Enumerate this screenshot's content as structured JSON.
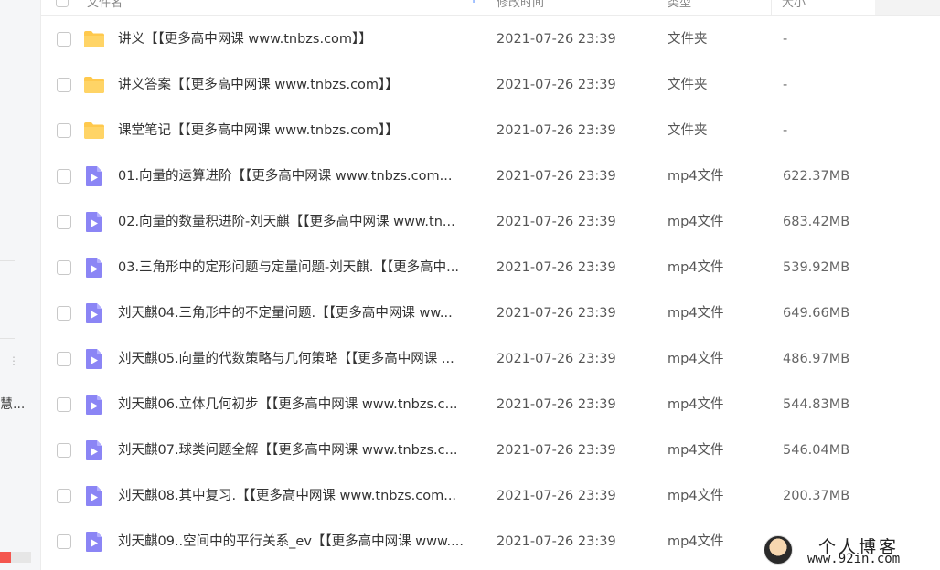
{
  "sidebar": {
    "truncated_text": "慧...",
    "dots": "⋮"
  },
  "header": {
    "name_label": "文件名",
    "time_label": "修改时间",
    "type_label": "类型",
    "size_label": "大小",
    "sort_glyph": "↑"
  },
  "files": [
    {
      "name": "讲义【【更多高中网课 www.tnbzs.com】】",
      "modified": "2021-07-26 23:39",
      "type": "文件夹",
      "size": "-",
      "icon": "folder-icon"
    },
    {
      "name": "讲义答案【【更多高中网课 www.tnbzs.com】】",
      "modified": "2021-07-26 23:39",
      "type": "文件夹",
      "size": "-",
      "icon": "folder-icon"
    },
    {
      "name": "课堂笔记【【更多高中网课 www.tnbzs.com】】",
      "modified": "2021-07-26 23:39",
      "type": "文件夹",
      "size": "-",
      "icon": "folder-icon"
    },
    {
      "name": "01.向量的运算进阶【【更多高中网课 www.tnbzs.com...",
      "modified": "2021-07-26 23:39",
      "type": "mp4文件",
      "size": "622.37MB",
      "icon": "video-file-icon"
    },
    {
      "name": "02.向量的数量积进阶-刘天麒【【更多高中网课 www.tn...",
      "modified": "2021-07-26 23:39",
      "type": "mp4文件",
      "size": "683.42MB",
      "icon": "video-file-icon"
    },
    {
      "name": "03.三角形中的定形问题与定量问题-刘天麒.【【更多高中...",
      "modified": "2021-07-26 23:39",
      "type": "mp4文件",
      "size": "539.92MB",
      "icon": "video-file-icon"
    },
    {
      "name": "刘天麒04.三角形中的不定量问题.【【更多高中网课 ww...",
      "modified": "2021-07-26 23:39",
      "type": "mp4文件",
      "size": "649.66MB",
      "icon": "video-file-icon"
    },
    {
      "name": "刘天麒05.向量的代数策略与几何策略【【更多高中网课 ...",
      "modified": "2021-07-26 23:39",
      "type": "mp4文件",
      "size": "486.97MB",
      "icon": "video-file-icon"
    },
    {
      "name": "刘天麒06.立体几何初步【【更多高中网课 www.tnbzs.c...",
      "modified": "2021-07-26 23:39",
      "type": "mp4文件",
      "size": "544.83MB",
      "icon": "video-file-icon"
    },
    {
      "name": "刘天麒07.球类问题全解【【更多高中网课 www.tnbzs.c...",
      "modified": "2021-07-26 23:39",
      "type": "mp4文件",
      "size": "546.04MB",
      "icon": "video-file-icon"
    },
    {
      "name": "刘天麒08.其中复习.【【更多高中网课 www.tnbzs.com...",
      "modified": "2021-07-26 23:39",
      "type": "mp4文件",
      "size": "200.37MB",
      "icon": "video-file-icon"
    },
    {
      "name": "刘天麒09..空间中的平行关系_ev【【更多高中网课 www....",
      "modified": "2021-07-26 23:39",
      "type": "mp4文件",
      "size": "",
      "icon": "video-file-icon"
    }
  ],
  "watermark": {
    "title": "个人博客",
    "url": "www.92in.com"
  },
  "colors": {
    "folder": "#ffc94d",
    "video": "#8b85f5",
    "accent": "#4a88ff",
    "progress": "#f4564f"
  }
}
